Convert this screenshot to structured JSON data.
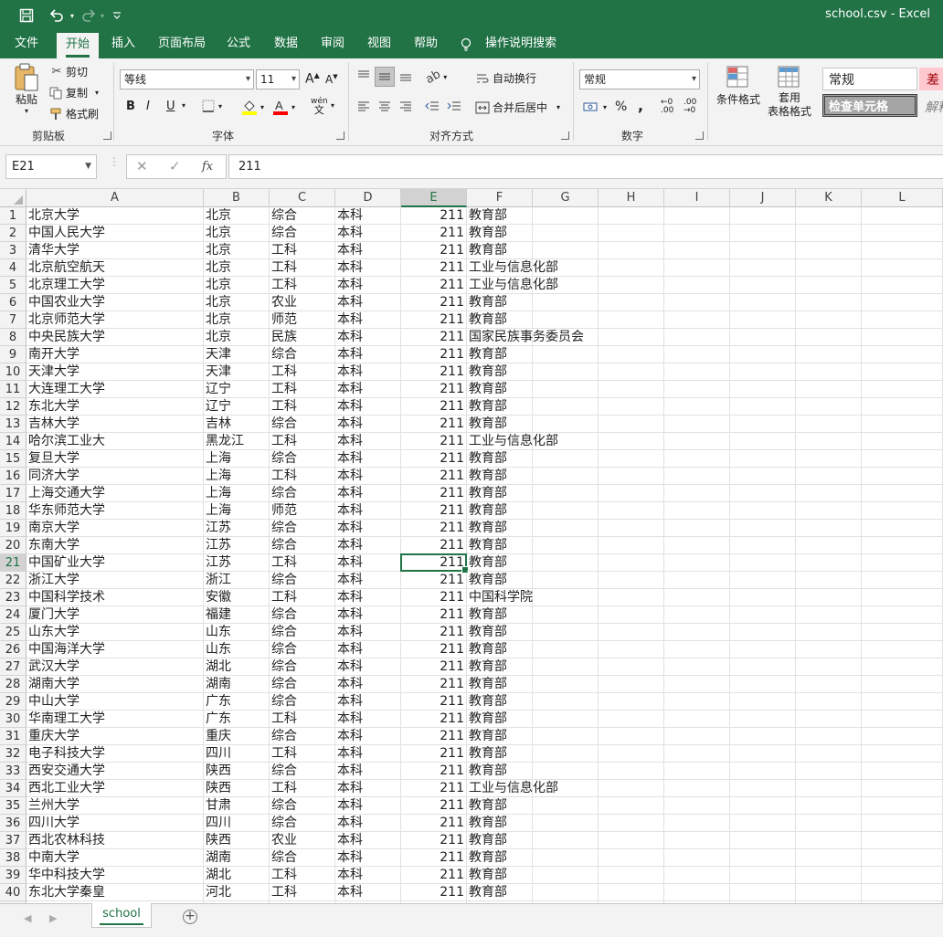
{
  "window": {
    "title": "school.csv  -  Excel",
    "quick_access": {
      "save_icon": "save-icon",
      "undo_icon": "undo-icon",
      "redo_icon": "redo-icon",
      "customize_icon": "customize-qat-icon"
    }
  },
  "ribbon_tabs": [
    "文件",
    "开始",
    "插入",
    "页面布局",
    "公式",
    "数据",
    "审阅",
    "视图",
    "帮助",
    "操作说明搜索"
  ],
  "active_tab": "开始",
  "ribbon": {
    "clipboard": {
      "paste": "粘贴",
      "cut": "剪切",
      "copy": "复制",
      "format_painter": "格式刷",
      "label": "剪贴板"
    },
    "font": {
      "font_name": "等线",
      "font_size": "11",
      "bold": "B",
      "italic": "I",
      "underline": "U",
      "phonetic": "wén",
      "label": "字体"
    },
    "alignment": {
      "wrap_text": "自动换行",
      "merge_center": "合并后居中",
      "label": "对齐方式"
    },
    "number": {
      "format": "常规",
      "percent": "%",
      "comma": ",",
      "label": "数字"
    },
    "styles": {
      "conditional": "条件格式",
      "table_format_line1": "套用",
      "table_format_line2": "表格格式",
      "style_normal": "常规",
      "style_check": "检查单元格",
      "style_bad": "差",
      "style_explain": "解释"
    }
  },
  "formula_bar": {
    "name_box": "E21",
    "cancel": "✕",
    "enter": "✓",
    "fx": "fx",
    "content": "211"
  },
  "columns": [
    "A",
    "B",
    "C",
    "D",
    "E",
    "F",
    "G",
    "H",
    "I",
    "J",
    "K",
    "L"
  ],
  "selected_cell": {
    "column": "E",
    "row": 21
  },
  "rows": [
    [
      "北京大学",
      "北京",
      "综合",
      "本科",
      "211",
      "教育部"
    ],
    [
      "中国人民大学",
      "北京",
      "综合",
      "本科",
      "211",
      "教育部"
    ],
    [
      "清华大学",
      "北京",
      "工科",
      "本科",
      "211",
      "教育部"
    ],
    [
      "北京航空航天",
      "北京",
      "工科",
      "本科",
      "211",
      "工业与信息化部"
    ],
    [
      "北京理工大学",
      "北京",
      "工科",
      "本科",
      "211",
      "工业与信息化部"
    ],
    [
      "中国农业大学",
      "北京",
      "农业",
      "本科",
      "211",
      "教育部"
    ],
    [
      "北京师范大学",
      "北京",
      "师范",
      "本科",
      "211",
      "教育部"
    ],
    [
      "中央民族大学",
      "北京",
      "民族",
      "本科",
      "211",
      "国家民族事务委员会"
    ],
    [
      "南开大学",
      "天津",
      "综合",
      "本科",
      "211",
      "教育部"
    ],
    [
      "天津大学",
      "天津",
      "工科",
      "本科",
      "211",
      "教育部"
    ],
    [
      "大连理工大学",
      "辽宁",
      "工科",
      "本科",
      "211",
      "教育部"
    ],
    [
      "东北大学",
      "辽宁",
      "工科",
      "本科",
      "211",
      "教育部"
    ],
    [
      "吉林大学",
      "吉林",
      "综合",
      "本科",
      "211",
      "教育部"
    ],
    [
      "哈尔滨工业大",
      "黑龙江",
      "工科",
      "本科",
      "211",
      "工业与信息化部"
    ],
    [
      "复旦大学",
      "上海",
      "综合",
      "本科",
      "211",
      "教育部"
    ],
    [
      "同济大学",
      "上海",
      "工科",
      "本科",
      "211",
      "教育部"
    ],
    [
      "上海交通大学",
      "上海",
      "综合",
      "本科",
      "211",
      "教育部"
    ],
    [
      "华东师范大学",
      "上海",
      "师范",
      "本科",
      "211",
      "教育部"
    ],
    [
      "南京大学",
      "江苏",
      "综合",
      "本科",
      "211",
      "教育部"
    ],
    [
      "东南大学",
      "江苏",
      "综合",
      "本科",
      "211",
      "教育部"
    ],
    [
      "中国矿业大学",
      "江苏",
      "工科",
      "本科",
      "211",
      "教育部"
    ],
    [
      "浙江大学",
      "浙江",
      "综合",
      "本科",
      "211",
      "教育部"
    ],
    [
      "中国科学技术",
      "安徽",
      "工科",
      "本科",
      "211",
      "中国科学院"
    ],
    [
      "厦门大学",
      "福建",
      "综合",
      "本科",
      "211",
      "教育部"
    ],
    [
      "山东大学",
      "山东",
      "综合",
      "本科",
      "211",
      "教育部"
    ],
    [
      "中国海洋大学",
      "山东",
      "综合",
      "本科",
      "211",
      "教育部"
    ],
    [
      "武汉大学",
      "湖北",
      "综合",
      "本科",
      "211",
      "教育部"
    ],
    [
      "湖南大学",
      "湖南",
      "综合",
      "本科",
      "211",
      "教育部"
    ],
    [
      "中山大学",
      "广东",
      "综合",
      "本科",
      "211",
      "教育部"
    ],
    [
      "华南理工大学",
      "广东",
      "工科",
      "本科",
      "211",
      "教育部"
    ],
    [
      "重庆大学",
      "重庆",
      "综合",
      "本科",
      "211",
      "教育部"
    ],
    [
      "电子科技大学",
      "四川",
      "工科",
      "本科",
      "211",
      "教育部"
    ],
    [
      "西安交通大学",
      "陕西",
      "综合",
      "本科",
      "211",
      "教育部"
    ],
    [
      "西北工业大学",
      "陕西",
      "工科",
      "本科",
      "211",
      "工业与信息化部"
    ],
    [
      "兰州大学",
      "甘肃",
      "综合",
      "本科",
      "211",
      "教育部"
    ],
    [
      "四川大学",
      "四川",
      "综合",
      "本科",
      "211",
      "教育部"
    ],
    [
      "西北农林科技",
      "陕西",
      "农业",
      "本科",
      "211",
      "教育部"
    ],
    [
      "中南大学",
      "湖南",
      "综合",
      "本科",
      "211",
      "教育部"
    ],
    [
      "华中科技大学",
      "湖北",
      "工科",
      "本科",
      "211",
      "教育部"
    ],
    [
      "东北大学秦皇",
      "河北",
      "工科",
      "本科",
      "211",
      "教育部"
    ]
  ],
  "sheet_tabs": [
    "school"
  ],
  "colors": {
    "accent": "#217346",
    "ribbon_bg": "#f3f3f3",
    "bad_style_bg": "#ffc7ce",
    "bad_style_text": "#9c0006"
  }
}
